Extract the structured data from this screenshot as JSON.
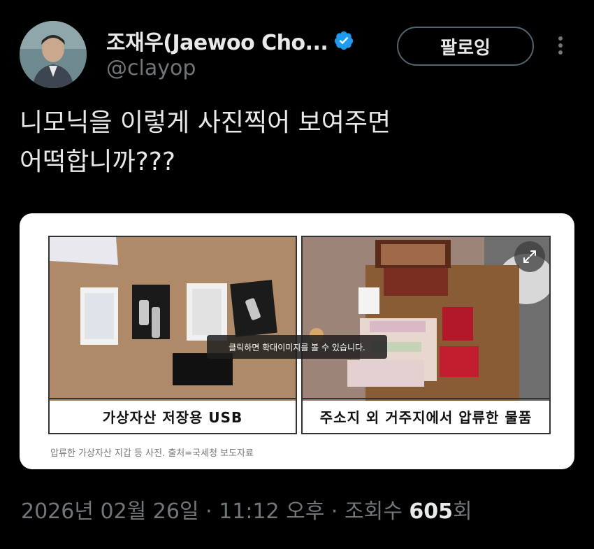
{
  "user": {
    "display_name": "조재우(Jaewoo Cho...",
    "handle": "@clayop",
    "verified": true
  },
  "actions": {
    "follow_label": "팔로잉"
  },
  "tweet": {
    "text": "니모닉을 이렇게 사진찍어 보여주면\n어떡합니까???"
  },
  "media": {
    "left_caption": "가상자산 저장용 USB",
    "right_caption": "주소지 외 거주지에서 압류한 물품",
    "tooltip": "클릭하면 확대이미지를 볼 수 있습니다.",
    "source": "압류한 가상자산 지갑 등 사진. 출처=국세청 보도자료"
  },
  "meta": {
    "date": "2026년 02월 26일",
    "sep1": " · ",
    "time": "11:12 오후",
    "sep2": " · ",
    "views_label": "조회수 ",
    "views_count": "605",
    "views_suffix": "회"
  },
  "colors": {
    "background": "#000000",
    "text_primary": "#e7e9ea",
    "text_secondary": "#71767b",
    "verified": "#1d9bf0"
  }
}
